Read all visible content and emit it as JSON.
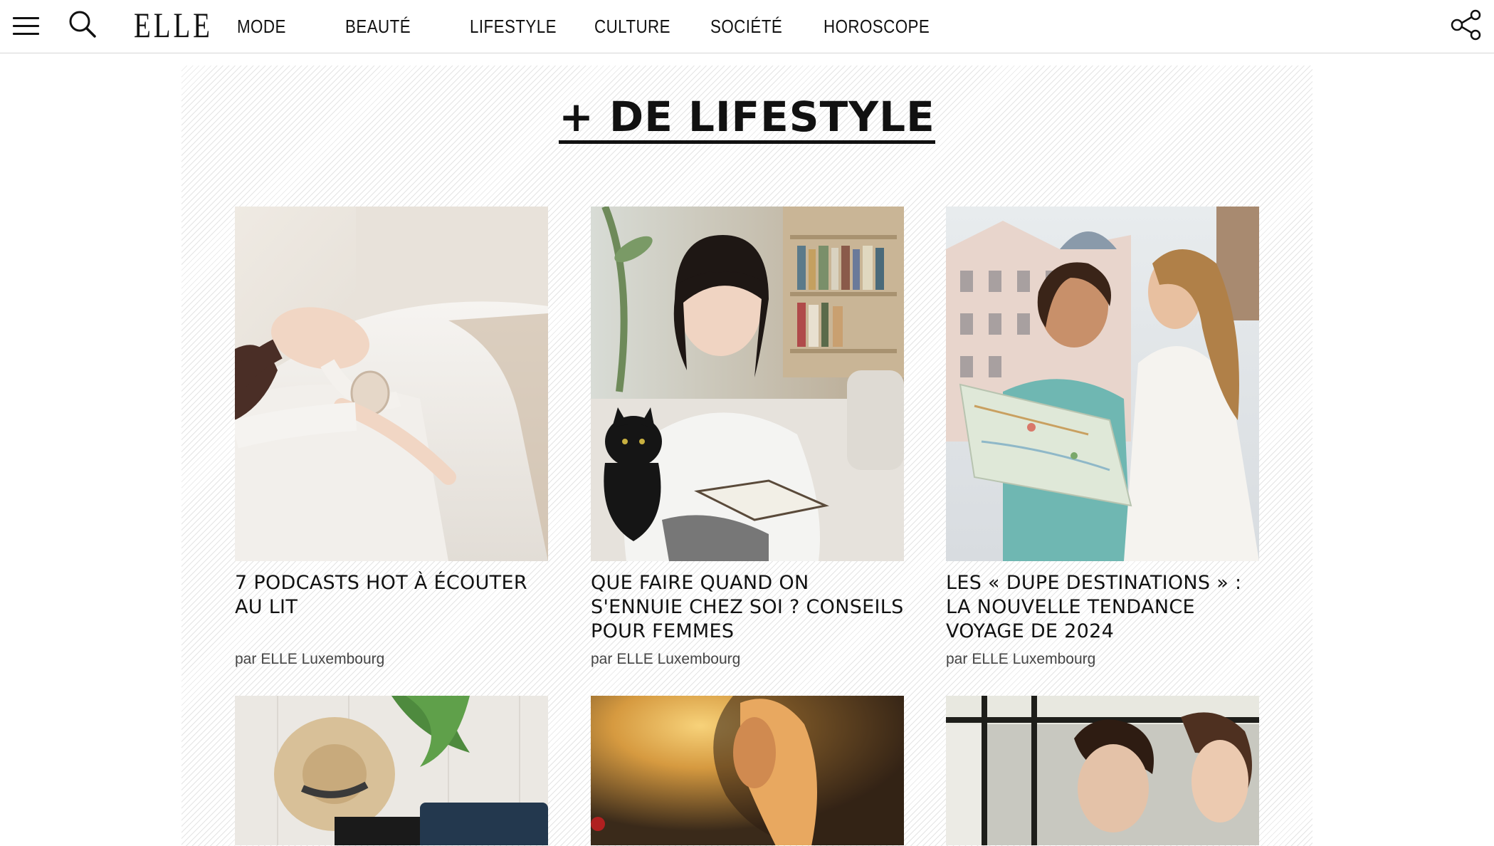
{
  "header": {
    "logo": "ELLE",
    "nav": [
      "MODE",
      "BEAUTÉ",
      "LIFESTYLE",
      "CULTURE",
      "SOCIÉTÉ",
      "HOROSCOPE"
    ]
  },
  "section": {
    "title": "+ DE LIFESTYLE",
    "articles": [
      {
        "title": "7 PODCASTS HOT À ÉCOUTER AU LIT",
        "author_prefix": "par",
        "author": "ELLE Luxembourg",
        "image": "woman-headphones-bed"
      },
      {
        "title": "QUE FAIRE QUAND ON S'ENNUIE CHEZ SOI ? CONSEILS POUR FEMMES",
        "author_prefix": "par",
        "author": "ELLE Luxembourg",
        "image": "girl-reading-with-cat"
      },
      {
        "title": "LES « DUPE DESTINATIONS » : LA NOUVELLE TENDANCE VOYAGE DE 2024",
        "author_prefix": "par",
        "author": "ELLE Luxembourg",
        "image": "women-with-map"
      }
    ],
    "more_images": [
      "suitcase-hat-plant",
      "woman-sunset",
      "young-couple"
    ]
  },
  "colors": {
    "text": "#111111",
    "muted": "#444444",
    "border": "#d6d6d6",
    "stripe": "#e4e4e4"
  }
}
